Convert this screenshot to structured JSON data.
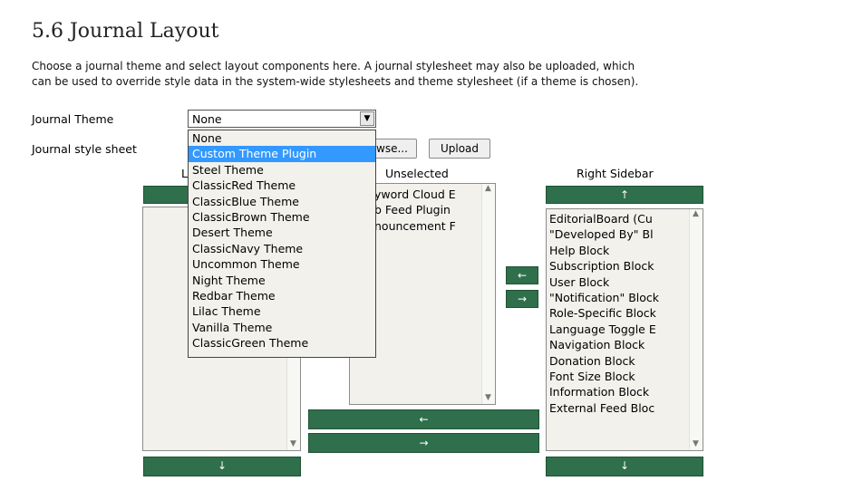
{
  "page": {
    "title": "5.6 Journal Layout",
    "description_line1": "Choose a journal theme and select layout components here. A journal stylesheet may also be uploaded, which",
    "description_line2": "can be used to override style data in the system-wide stylesheets and theme stylesheet (if a theme is chosen)."
  },
  "form": {
    "theme_label": "Journal Theme",
    "theme_selected": "None",
    "stylesheet_label": "Journal style sheet",
    "browse_label": "wse...",
    "upload_label": "Upload"
  },
  "theme_options": [
    "None",
    "Custom Theme Plugin",
    "Steel Theme",
    "ClassicRed Theme",
    "ClassicBlue Theme",
    "ClassicBrown Theme",
    "Desert Theme",
    "ClassicNavy Theme",
    "Uncommon Theme",
    "Night Theme",
    "Redbar Theme",
    "Lilac Theme",
    "Vanilla Theme",
    "ClassicGreen Theme"
  ],
  "highlighted_option": "Custom Theme Plugin",
  "left_sidebar": {
    "heading": "L",
    "up": "↑",
    "down": "↓"
  },
  "unselected": {
    "heading": "Unselected",
    "items": [
      "yword Cloud E",
      "b Feed Plugin",
      "nouncement F"
    ],
    "move_left": "←",
    "move_right": "→"
  },
  "transfer": {
    "to_left": "←",
    "to_right": "→"
  },
  "right_sidebar": {
    "heading": "Right Sidebar",
    "up": "↑",
    "down": "↓",
    "items": [
      "EditorialBoard (Cu",
      "\"Developed By\" Bl",
      "Help Block",
      "Subscription Block",
      "User Block",
      "\"Notification\" Block",
      "Role-Specific Block",
      "Language Toggle E",
      "Navigation Block",
      "Donation Block",
      "Font Size Block",
      "Information Block",
      "External Feed Bloc"
    ]
  },
  "colors": {
    "green": "#2f6f4b",
    "highlight": "#3399ff",
    "list_bg": "#f2f1ec"
  }
}
